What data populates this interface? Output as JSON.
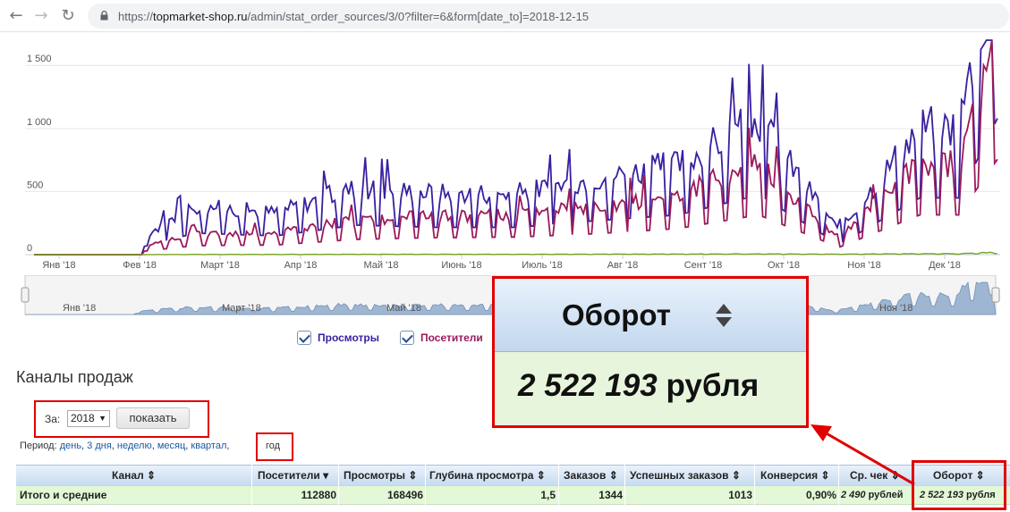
{
  "browser": {
    "url_prefix": "https://",
    "url_host": "topmarket-shop.ru",
    "url_path": "/admin/stat_order_sources/3/0?filter=6&form[date_to]=2018-12-15"
  },
  "chart_data": {
    "type": "line",
    "x_labels": [
      "Янв '18",
      "Фев '18",
      "Март '18",
      "Апр '18",
      "Май '18",
      "Июнь '18",
      "Июль '18",
      "Авг '18",
      "Сент '18",
      "Окт '18",
      "Ноя '18",
      "Дек '18"
    ],
    "y_ticks": [
      "0",
      "500",
      "1 000",
      "1 500"
    ],
    "ylim": [
      0,
      1700
    ],
    "grid": true,
    "series": [
      {
        "name": "Просмотры",
        "color": "#3a1fa0",
        "monthly_approx": [
          0,
          5,
          380,
          330,
          520,
          480,
          480,
          600,
          700,
          1050,
          180,
          1000
        ]
      },
      {
        "name": "Посетители",
        "color": "#9a1a5a",
        "monthly_approx": [
          0,
          3,
          160,
          170,
          270,
          300,
          310,
          370,
          460,
          700,
          130,
          700
        ]
      },
      {
        "name": "",
        "color": "#7aa321",
        "monthly_approx": [
          0,
          0,
          2,
          2,
          3,
          3,
          3,
          4,
          5,
          6,
          4,
          8
        ]
      }
    ],
    "navigator_labels": [
      "Янв '18",
      "Март '18",
      "Май '18",
      "Ноя '18"
    ]
  },
  "legend": {
    "views": "Просмотры",
    "visitors": "Посетители",
    "views_color": "#3a1fa0",
    "visitors_color": "#9a1a5a"
  },
  "section_title": "Каналы продаж",
  "period_form": {
    "za_label": "За:",
    "year_value": "2018",
    "show_button": "показать"
  },
  "period_links": {
    "label": "Период:",
    "day": "день",
    "three_days": "3 дня",
    "week": "неделю",
    "month": "месяц",
    "quarter": "квартал",
    "year": "год"
  },
  "table": {
    "headers": {
      "channel": "Канал",
      "visitors": "Посетители",
      "views": "Просмотры",
      "depth": "Глубина просмотра",
      "orders": "Заказов",
      "successful": "Успешных заказов",
      "conversion": "Конверсия",
      "avg_check": "Ср. чек",
      "turnover": "Оборот"
    },
    "total_row": {
      "channel": "Итого и средние",
      "visitors": "112880",
      "views": "168496",
      "depth": "1,5",
      "orders": "1344",
      "successful": "1013",
      "conversion": "0,90%",
      "avg_check_num": "2 490",
      "avg_check_unit": "рублей",
      "turnover_num": "2 522 193",
      "turnover_unit": "рубля"
    }
  },
  "zoom_callout": {
    "title": "Оборот",
    "value_num": "2 522 193",
    "value_unit": "рубля"
  },
  "colors": {
    "highlight": "#e00000",
    "header_grad_top": "#eaf2fb",
    "row_green": "#e3f8d6"
  }
}
